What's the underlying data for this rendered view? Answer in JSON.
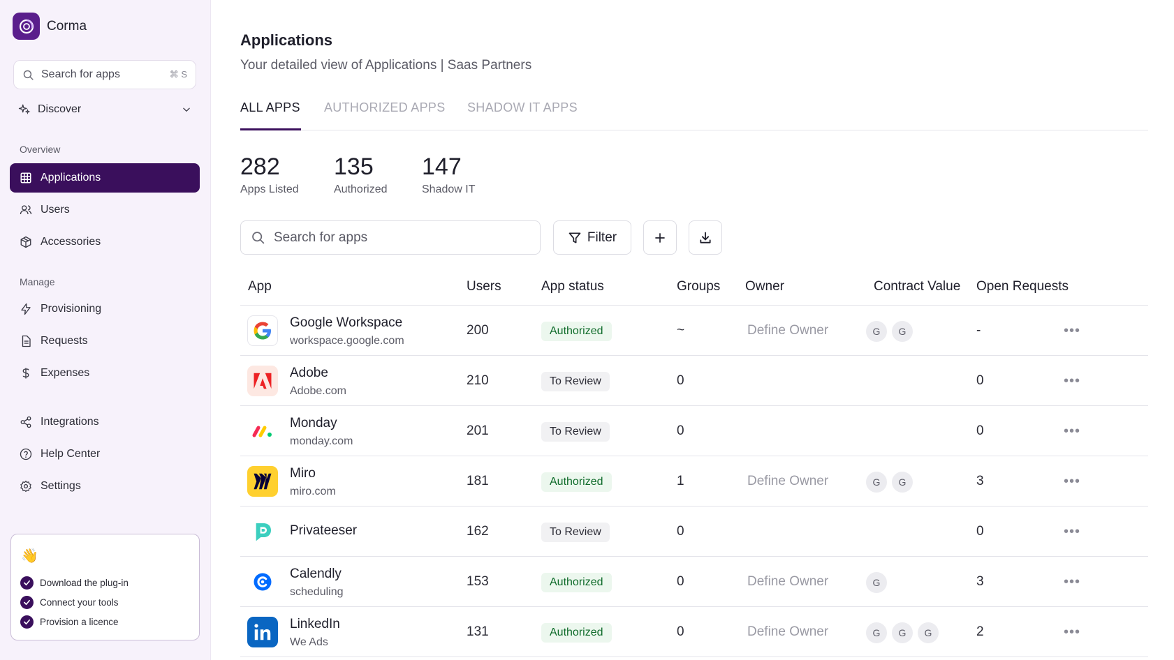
{
  "brand": {
    "name": "Corma",
    "color": "#5a1e8c"
  },
  "sidebar": {
    "search_placeholder": "Search for apps",
    "search_shortcut": "⌘ S",
    "discover_label": "Discover",
    "overview_label": "Overview",
    "manage_label": "Manage",
    "overview_items": [
      {
        "label": "Applications",
        "icon": "grid-icon",
        "active": true
      },
      {
        "label": "Users",
        "icon": "users-icon"
      },
      {
        "label": "Accessories",
        "icon": "box-icon"
      }
    ],
    "manage_items": [
      {
        "label": "Provisioning",
        "icon": "lightning-icon"
      },
      {
        "label": "Requests",
        "icon": "document-icon"
      },
      {
        "label": "Expenses",
        "icon": "dollar-icon"
      }
    ],
    "other_items": [
      {
        "label": "Integrations",
        "icon": "share-icon"
      },
      {
        "label": "Help Center",
        "icon": "help-icon"
      },
      {
        "label": "Settings",
        "icon": "gear-icon"
      }
    ],
    "onboarding": {
      "emoji": "👋",
      "steps": [
        "Download the plug-in",
        "Connect your tools",
        "Provision a licence"
      ]
    }
  },
  "main": {
    "title": "Applications",
    "subtitle": "Your detailed view of Applications | Saas Partners",
    "tabs": [
      {
        "label": "ALL APPS",
        "active": true
      },
      {
        "label": "AUTHORIZED APPS"
      },
      {
        "label": "SHADOW IT APPS"
      }
    ],
    "stats": [
      {
        "value": "282",
        "label": "Apps Listed"
      },
      {
        "value": "135",
        "label": "Authorized"
      },
      {
        "value": "147",
        "label": "Shadow IT"
      }
    ],
    "search_placeholder": "Search for apps",
    "filter_label": "Filter",
    "table": {
      "columns": [
        "App",
        "Users",
        "App status",
        "Groups",
        "Owner",
        "Contract Value",
        "Open Requests"
      ],
      "rows": [
        {
          "name": "Google Workspace",
          "domain": "workspace.google.com",
          "users": "200",
          "status": "Authorized",
          "groups": "~",
          "owner": "Define Owner",
          "contract": [
            "G",
            "G"
          ],
          "requests": "-"
        },
        {
          "name": "Adobe",
          "domain": "Adobe.com",
          "users": "210",
          "status": "To Review",
          "groups": "0",
          "owner": "",
          "contract": [],
          "requests": "0"
        },
        {
          "name": "Monday",
          "domain": "monday.com",
          "users": "201",
          "status": "To Review",
          "groups": "0",
          "owner": "",
          "contract": [],
          "requests": "0"
        },
        {
          "name": "Miro",
          "domain": "miro.com",
          "users": "181",
          "status": "Authorized",
          "groups": "1",
          "owner": "Define Owner",
          "contract": [
            "G",
            "G"
          ],
          "requests": "3"
        },
        {
          "name": "Privateeser",
          "domain": "",
          "users": "162",
          "status": "To Review",
          "groups": "0",
          "owner": "",
          "contract": [],
          "requests": "0"
        },
        {
          "name": "Calendly",
          "domain": "scheduling",
          "users": "153",
          "status": "Authorized",
          "groups": "0",
          "owner": "Define Owner",
          "contract": [
            "G"
          ],
          "requests": "3"
        },
        {
          "name": "LinkedIn",
          "domain": "We Ads",
          "users": "131",
          "status": "Authorized",
          "groups": "0",
          "owner": "Define Owner",
          "contract": [
            "G",
            "G",
            "G"
          ],
          "requests": "2"
        }
      ]
    }
  },
  "colors": {
    "accent": "#3a0f5c",
    "authorized_bg": "#ecf7ee",
    "authorized_text": "#0f6b2a",
    "review_bg": "#f1f1f3"
  }
}
